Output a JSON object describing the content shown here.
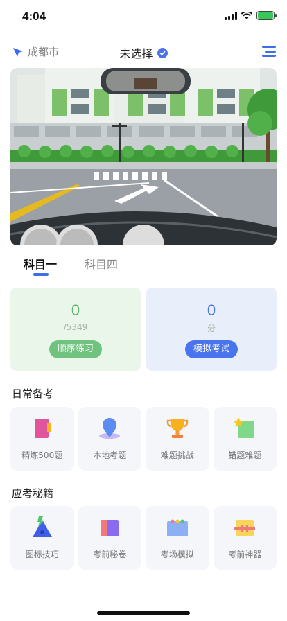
{
  "status_bar": {
    "time": "4:04"
  },
  "header": {
    "city": "成都市",
    "selector": "未选择"
  },
  "tabs": [
    {
      "label": "科目一",
      "active": true
    },
    {
      "label": "科目四",
      "active": false
    }
  ],
  "cards": {
    "practice": {
      "value": "0",
      "sub": "/5349",
      "button": "顺序练习"
    },
    "exam": {
      "value": "0",
      "sub": "分",
      "button": "模拟考试"
    }
  },
  "daily": {
    "title": "日常备考",
    "items": [
      {
        "label": "精炼500题",
        "icon": "book-icon"
      },
      {
        "label": "本地考题",
        "icon": "location-pin-icon"
      },
      {
        "label": "难题挑战",
        "icon": "trophy-icon"
      },
      {
        "label": "错题难题",
        "icon": "star-note-icon"
      }
    ]
  },
  "secrets": {
    "title": "应考秘籍",
    "items": [
      {
        "label": "图标技巧",
        "icon": "triangle-sign-icon"
      },
      {
        "label": "考前秘卷",
        "icon": "cards-icon"
      },
      {
        "label": "考场模拟",
        "icon": "screen-icon"
      },
      {
        "label": "考前神器",
        "icon": "ticket-icon"
      }
    ]
  },
  "colors": {
    "accent": "#4a74ee",
    "green": "#5bb56a",
    "green_bg": "#ebf6ea",
    "blue_bg": "#e9eefb"
  }
}
